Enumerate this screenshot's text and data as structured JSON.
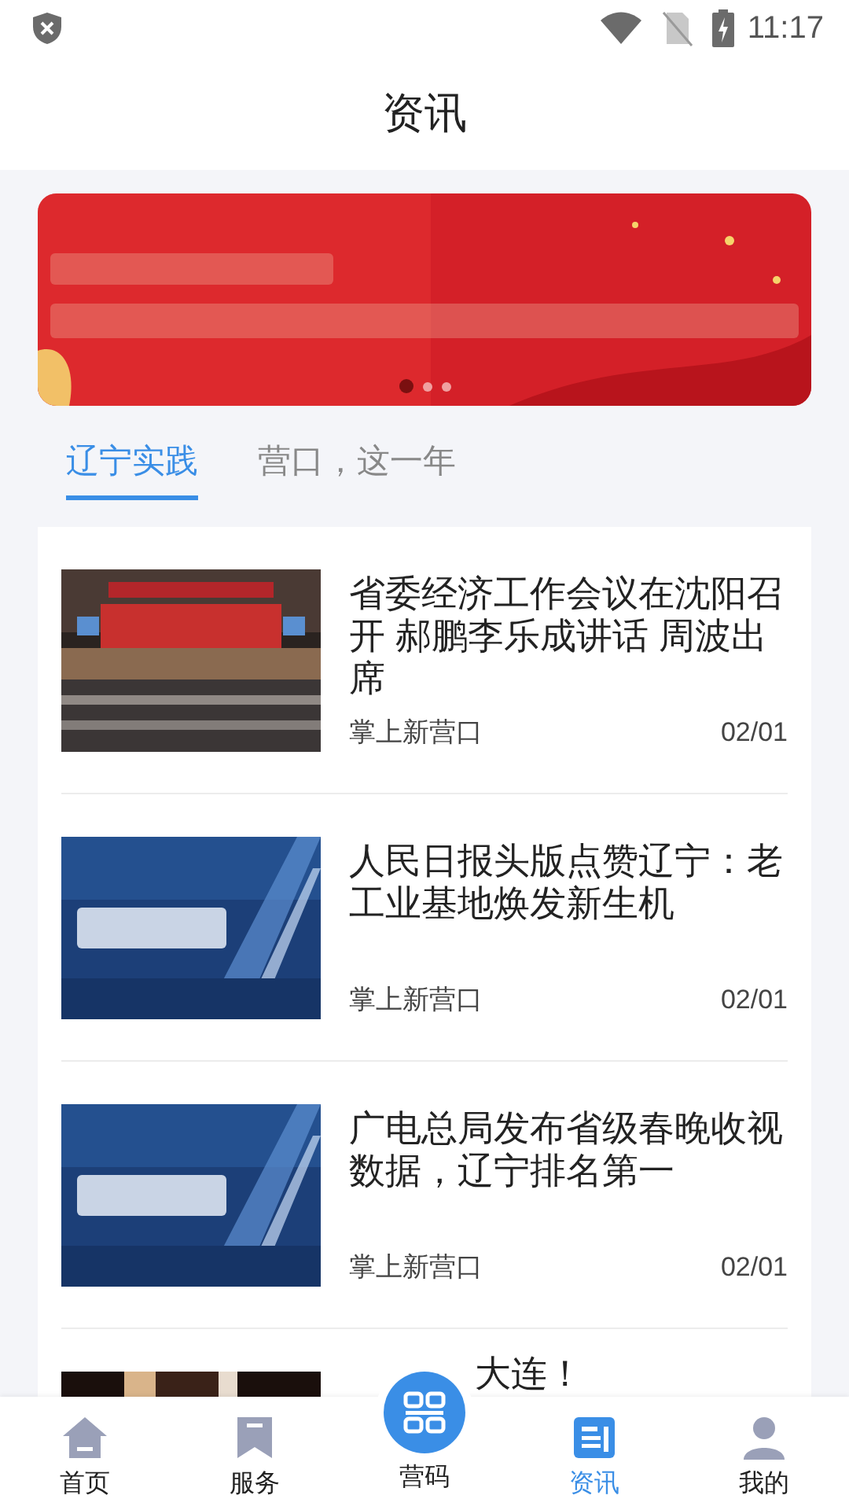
{
  "status_bar": {
    "time": "11:17"
  },
  "header": {
    "title": "资讯"
  },
  "banner": {
    "pages": [
      {
        "selected": true
      },
      {
        "selected": false
      },
      {
        "selected": false
      }
    ]
  },
  "tabs": [
    {
      "label": "辽宁实践",
      "selected": true
    },
    {
      "label": "营口，这一年",
      "selected": false
    }
  ],
  "articles": [
    {
      "title": "省委经济工作会议在沈阳召开 郝鹏李乐成讲话 周波出席",
      "source": "掌上新营口",
      "date": "02/01"
    },
    {
      "title": "人民日报头版点赞辽宁：老工业基地焕发新生机",
      "source": "掌上新营口",
      "date": "02/01"
    },
    {
      "title": "广电总局发布省级春晚收视数据，辽宁排名第一",
      "source": "掌上新营口",
      "date": "02/01"
    },
    {
      "title": "大连！"
    }
  ],
  "nav": [
    {
      "kind": "home",
      "label": "首页",
      "selected": false
    },
    {
      "kind": "bookmark",
      "label": "服务",
      "selected": false
    },
    {
      "kind": "qr",
      "label": "营码",
      "selected": false
    },
    {
      "kind": "news",
      "label": "资讯",
      "selected": true
    },
    {
      "kind": "person",
      "label": "我的",
      "selected": false
    }
  ]
}
